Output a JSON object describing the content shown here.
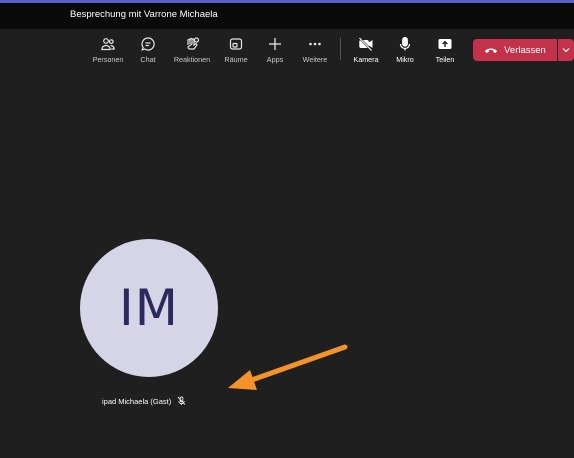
{
  "window": {
    "title": "Besprechung mit Varrone Michaela"
  },
  "toolbar": {
    "items": [
      {
        "label": "Personen",
        "icon": "people-icon"
      },
      {
        "label": "Chat",
        "icon": "chat-icon"
      },
      {
        "label": "Reaktionen",
        "icon": "reactions-icon"
      },
      {
        "label": "Räume",
        "icon": "rooms-icon"
      },
      {
        "label": "Apps",
        "icon": "plus-icon"
      },
      {
        "label": "Weitere",
        "icon": "more-icon"
      },
      {
        "label": "Kamera",
        "icon": "camera-off-icon"
      },
      {
        "label": "Mikro",
        "icon": "mic-icon"
      },
      {
        "label": "Teilen",
        "icon": "share-icon"
      }
    ],
    "leave_label": "Verlassen"
  },
  "participant": {
    "initials": "IM",
    "name": "ipad Michaela (Gast)",
    "muted": true
  },
  "colors": {
    "accent": "#5b5fc7",
    "leave": "#c4314b",
    "avatar_bg": "#d6d5e8",
    "avatar_text": "#2a2a5e",
    "arrow": "#f5932b"
  }
}
